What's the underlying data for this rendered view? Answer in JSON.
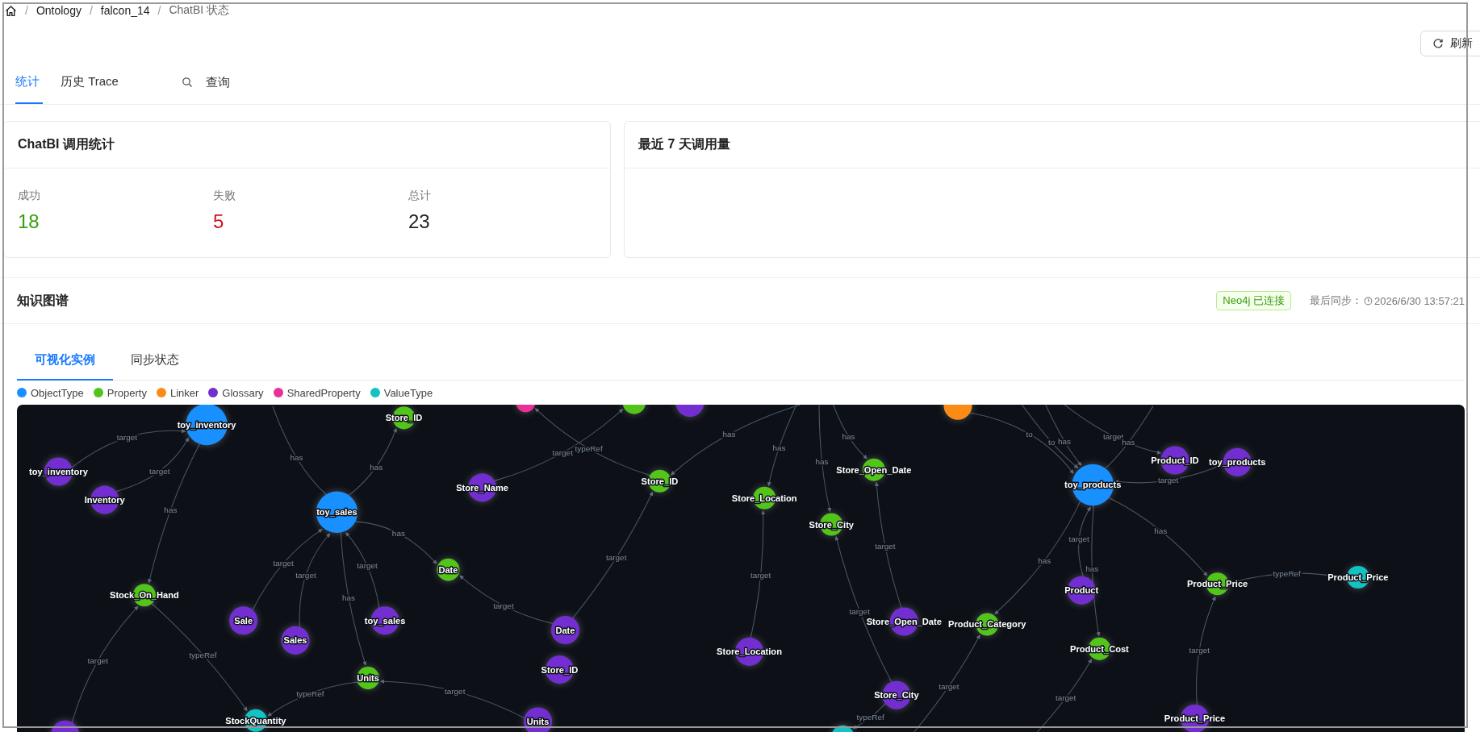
{
  "breadcrumb": [
    "Ontology",
    "falcon_14",
    "ChatBI 状态"
  ],
  "breadcrumb_separator": "/",
  "refresh_button": "刷新",
  "tabs": [
    {
      "label": "统计",
      "selected": true
    },
    {
      "label": "历史 Trace",
      "selected": false
    }
  ],
  "query_button": "查询",
  "stats_card": {
    "title": "ChatBI 调用统计",
    "items": [
      {
        "label": "成功",
        "value": "18",
        "kind": "success"
      },
      {
        "label": "失败",
        "value": "5",
        "kind": "error"
      },
      {
        "label": "总计",
        "value": "23",
        "kind": "default"
      }
    ]
  },
  "usage_card": {
    "title": "最近 7 天调用量"
  },
  "graph_section": {
    "title": "知识图谱",
    "status_badge": "Neo4j 已连接",
    "last_sync": "最后同步：",
    "last_sync_time": "2026/6/30 13:57:21",
    "subtabs": [
      {
        "label": "可视化实例",
        "selected": true
      },
      {
        "label": "同步状态",
        "selected": false
      }
    ],
    "legend": [
      {
        "label": "ObjectType",
        "color": "#1890ff"
      },
      {
        "label": "Property",
        "color": "#52c41a"
      },
      {
        "label": "Linker",
        "color": "#fa8c16"
      },
      {
        "label": "Glossary",
        "color": "#722ed1"
      },
      {
        "label": "SharedProperty",
        "color": "#eb2f96"
      },
      {
        "label": "ValueType",
        "color": "#13c2c2"
      }
    ],
    "nodes": [
      {
        "label": "toy_inventory",
        "kind": "object",
        "color": "#1890ff"
      },
      {
        "label": "toy_inventory",
        "kind": "glossary",
        "color": "#722ed1"
      },
      {
        "label": "Inventory",
        "kind": "glossary",
        "color": "#722ed1"
      },
      {
        "label": "Store_ID",
        "kind": "property",
        "color": "#52c41a"
      },
      {
        "kind": "shared",
        "color": "#eb2f96"
      },
      {
        "kind": "property",
        "color": "#52c41a"
      },
      {
        "kind": "glossary",
        "color": "#722ed1"
      },
      {
        "kind": "linker",
        "color": "#fa8c16"
      },
      {
        "label": "toy_sales",
        "kind": "object",
        "color": "#1890ff"
      },
      {
        "label": "Store_Name",
        "kind": "glossary",
        "color": "#722ed1"
      },
      {
        "label": "Store_ID",
        "kind": "property",
        "color": "#52c41a"
      },
      {
        "label": "Store_Location",
        "kind": "property",
        "color": "#52c41a"
      },
      {
        "label": "Store_Open_Date",
        "kind": "property",
        "color": "#52c41a"
      },
      {
        "label": "Store_City",
        "kind": "property",
        "color": "#52c41a"
      },
      {
        "label": "toy_products",
        "kind": "object",
        "color": "#1890ff"
      },
      {
        "label": "Product_ID",
        "kind": "glossary",
        "color": "#722ed1"
      },
      {
        "label": "toy_products",
        "kind": "glossary",
        "color": "#722ed1"
      },
      {
        "label": "Date",
        "kind": "property",
        "color": "#52c41a"
      },
      {
        "label": "Stock_On_Hand",
        "kind": "property",
        "color": "#52c41a"
      },
      {
        "label": "Sale",
        "kind": "glossary",
        "color": "#722ed1"
      },
      {
        "label": "Sales",
        "kind": "glossary",
        "color": "#722ed1"
      },
      {
        "label": "toy_sales",
        "kind": "glossary",
        "color": "#722ed1"
      },
      {
        "label": "Date",
        "kind": "glossary",
        "color": "#722ed1"
      },
      {
        "label": "Store_ID",
        "kind": "glossary",
        "color": "#722ed1"
      },
      {
        "label": "Units",
        "kind": "property",
        "color": "#52c41a"
      },
      {
        "label": "StockQuantity",
        "kind": "value",
        "color": "#13c2c2"
      },
      {
        "label": "Units",
        "kind": "glossary",
        "color": "#722ed1"
      },
      {
        "kind": "glossary",
        "color": "#722ed1"
      },
      {
        "label": "Store_Location",
        "kind": "glossary",
        "color": "#722ed1"
      },
      {
        "label": "Store_Open_Date",
        "kind": "glossary",
        "color": "#722ed1"
      },
      {
        "label": "Product_Category",
        "kind": "property",
        "color": "#52c41a"
      },
      {
        "label": "Product",
        "kind": "glossary",
        "color": "#722ed1"
      },
      {
        "label": "Product_Cost",
        "kind": "property",
        "color": "#52c41a"
      },
      {
        "label": "Product_Price",
        "kind": "property",
        "color": "#52c41a"
      },
      {
        "label": "Product_Price",
        "kind": "value",
        "color": "#13c2c2"
      },
      {
        "label": "Store_City",
        "kind": "glossary",
        "color": "#722ed1"
      },
      {
        "label": "Product_Price",
        "kind": "glossary",
        "color": "#722ed1"
      },
      {
        "kind": "value",
        "color": "#13c2c2"
      }
    ],
    "edges": [
      {
        "label": "target"
      },
      {
        "label": "target"
      },
      {
        "label": "has"
      },
      {
        "label": "has"
      },
      {
        "label": "has"
      },
      {
        "label": "target"
      },
      {
        "label": "target"
      },
      {
        "label": "target"
      },
      {
        "label": "has"
      },
      {
        "label": "has"
      },
      {
        "label": "target"
      },
      {
        "label": "target"
      },
      {
        "label": "typeRef"
      },
      {
        "label": "target"
      },
      {
        "label": "typeRef"
      },
      {
        "label": "target"
      },
      {
        "label": "target"
      },
      {
        "label": "typeRef"
      },
      {
        "label": "has"
      },
      {
        "label": "has"
      },
      {
        "label": "has"
      },
      {
        "label": "has"
      },
      {
        "label": "target"
      },
      {
        "label": "target"
      },
      {
        "label": "target"
      },
      {
        "label": "to"
      },
      {
        "label": "to"
      },
      {
        "label": "has"
      },
      {
        "label": "target"
      },
      {
        "label": "has"
      },
      {
        "label": "target"
      },
      {
        "label": "has"
      },
      {
        "label": "target"
      },
      {
        "label": "has"
      },
      {
        "label": "has"
      },
      {
        "label": "typeRef"
      },
      {
        "label": "target"
      },
      {
        "label": "typeRef"
      },
      {
        "label": "target"
      },
      {
        "label": "target"
      }
    ]
  }
}
